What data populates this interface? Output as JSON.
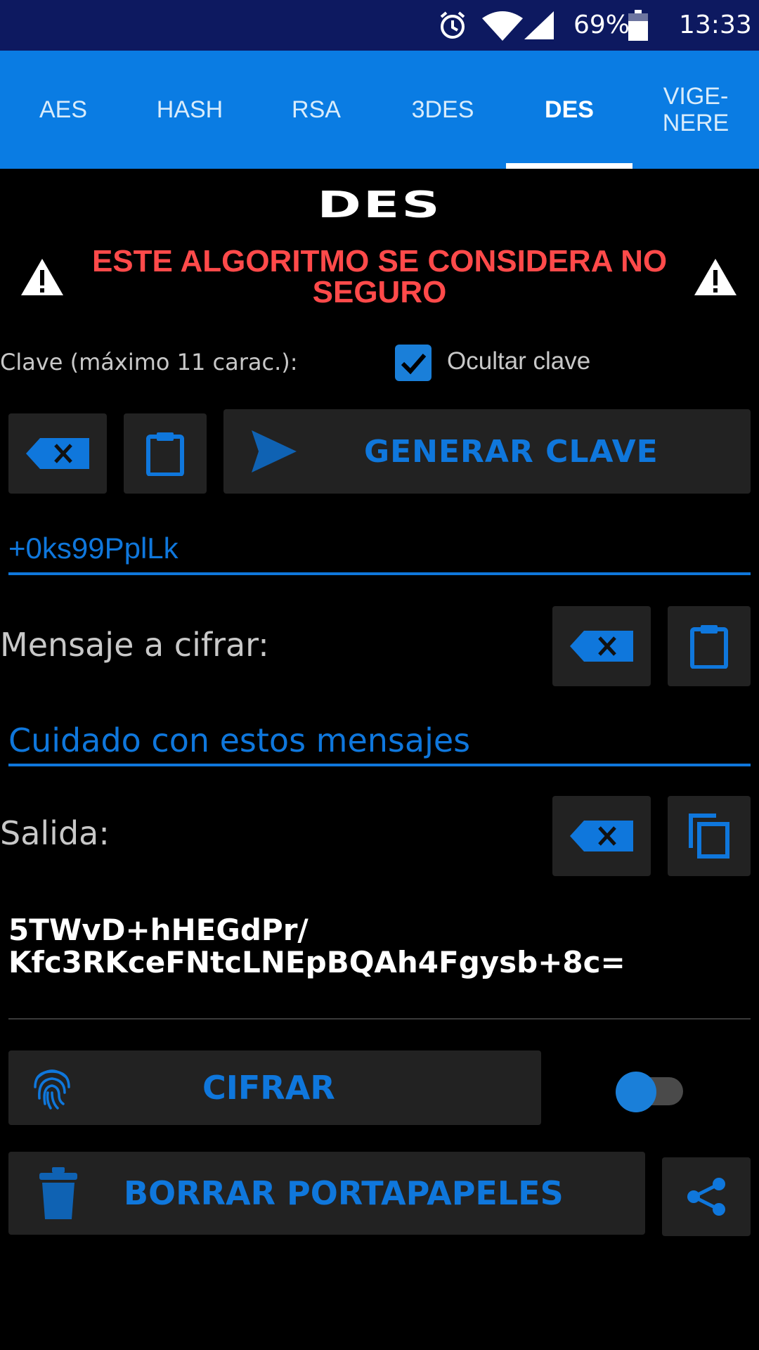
{
  "status_bar": {
    "battery": "69%",
    "time": "13:33"
  },
  "tabs": [
    {
      "label": "AES"
    },
    {
      "label": "HASH"
    },
    {
      "label": "RSA"
    },
    {
      "label": "3DES"
    },
    {
      "label": "DES"
    },
    {
      "label": "VIGE-\nNERE"
    }
  ],
  "active_tab": "DES",
  "title": "DES",
  "warning": "ESTE ALGORITMO SE CONSIDERA NO SEGURO",
  "key_section": {
    "label": "Clave (máximo 11 carac.):",
    "hide_key_label": "Ocultar clave",
    "hide_key_checked": true,
    "generate_button": "GENERAR CLAVE",
    "key_value": "+0ks99PplLk"
  },
  "message_section": {
    "label": "Mensaje a cifrar:",
    "message_value": "Cuidado con estos mensajes"
  },
  "output_section": {
    "label": "Salida:",
    "output_value": "5TWvD+hHEGdPr/\nKfc3RKceFNtcLNEpBQAh4Fgysb+8c="
  },
  "encrypt_button": "CIFRAR",
  "mode_toggle_on": false,
  "clear_clipboard_button": "BORRAR PORTAPAPELES",
  "colors": {
    "accent": "#0f77dc",
    "tab_bar": "#0a7ce3",
    "status_bar": "#0d1960",
    "warning": "#ff4a4a",
    "button_bg": "#222222"
  }
}
